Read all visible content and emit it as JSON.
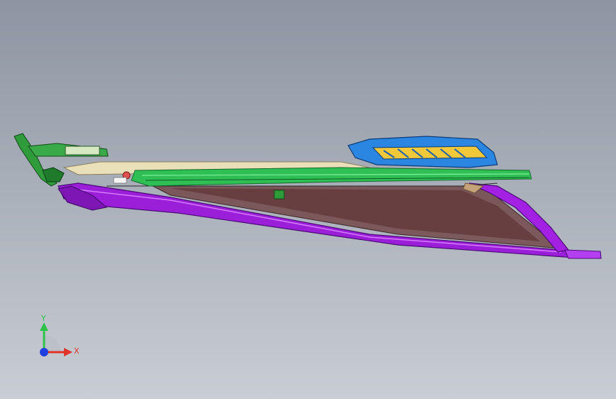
{
  "viewport": {
    "background_top": "#8d95a2",
    "background_bottom": "#c9cdd4"
  },
  "model": {
    "frame_color": "#9b1fd8",
    "panel_color": "#6b3a3a",
    "rail_color": "#2fbf55",
    "top_panel_color": "#e9dfb8",
    "housing_color": "#2a86e0",
    "bracket_color": "#2f9b3a"
  },
  "triad": {
    "x_label": "X",
    "y_label": "Y",
    "x_color": "#e0342b",
    "y_color": "#2ec24a",
    "z_color": "#1f3fe0"
  }
}
